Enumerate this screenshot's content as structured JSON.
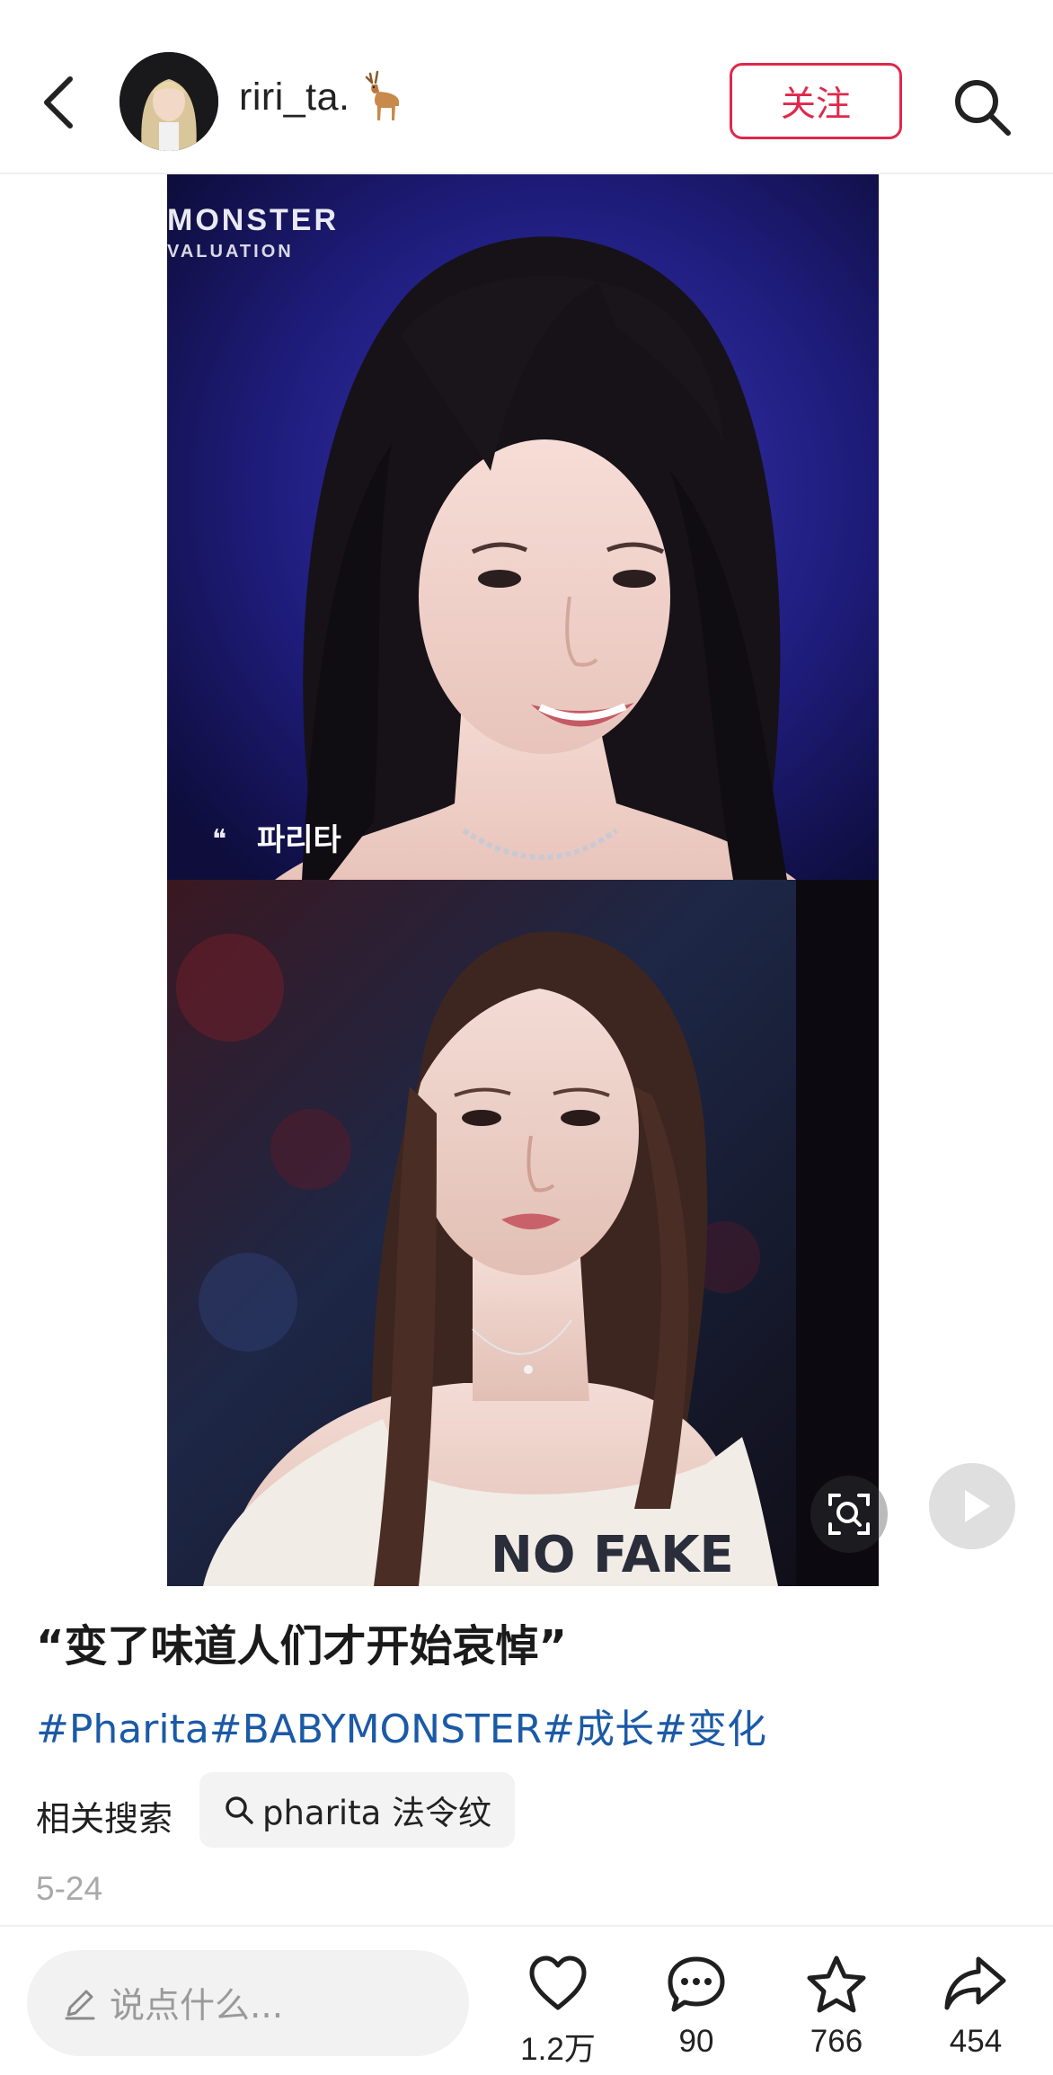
{
  "header": {
    "username": "riri_ta.",
    "follow_label": "关注"
  },
  "media": {
    "top_overlay_line1": "MONSTER",
    "top_overlay_line2": "VALUATION",
    "top_caption": "파리타",
    "shirt_text": "NO FAKE"
  },
  "post": {
    "title": "“变了味道人们才开始哀悼”",
    "tags": [
      "#Pharita",
      "#BABYMONSTER",
      "#成长",
      "#变化"
    ],
    "related_label": "相关搜索",
    "related_query": "pharita 法令纹",
    "date": "5-24"
  },
  "bottom": {
    "comment_placeholder": "说点什么...",
    "likes": "1.2万",
    "comments": "90",
    "favorites": "766",
    "shares": "454"
  },
  "colors": {
    "accent": "#e0284a",
    "hashtag": "#1b5aa6",
    "muted": "#a9a9a9"
  },
  "icons": [
    "back-arrow-icon",
    "deer-emoji-icon",
    "search-icon",
    "image-search-icon",
    "play-icon",
    "pencil-icon",
    "heart-icon",
    "comment-icon",
    "star-icon",
    "share-icon"
  ]
}
